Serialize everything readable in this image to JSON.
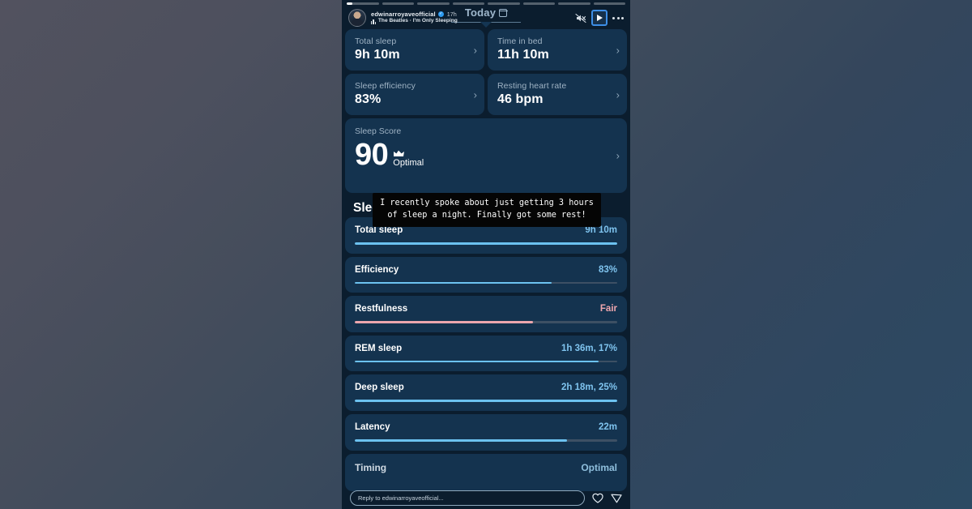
{
  "story": {
    "progress": {
      "segments": 8,
      "active_index": 0,
      "active_fill_percent": 18
    },
    "header": {
      "username": "edwinarroyaveofficial",
      "verified_glyph": "✓",
      "timestamp": "17h",
      "music": "The Beatles · I'm Only Sleeping",
      "mute_icon": "muted-speaker-icon",
      "play_icon": "play-icon",
      "more_icon": "more-options-icon"
    },
    "date_pill": {
      "label": "Today",
      "icon": "calendar-icon"
    },
    "caption": "I recently spoke about just getting 3 hours of sleep a night. Finally got some rest!",
    "reply": {
      "placeholder": "Reply to edwinarroyaveofficial...",
      "heart_icon": "heart-icon",
      "send_icon": "send-icon"
    }
  },
  "summary_cards": [
    {
      "label": "Total sleep",
      "value": "9h 10m",
      "chevron": "›"
    },
    {
      "label": "Time in bed",
      "value": "11h 10m",
      "chevron": "›"
    },
    {
      "label": "Sleep efficiency",
      "value": "83%",
      "chevron": "›"
    },
    {
      "label": "Resting heart rate",
      "value": "46 bpm",
      "chevron": "›"
    }
  ],
  "sleep_score": {
    "label": "Sleep Score",
    "score": "90",
    "tag": "Optimal",
    "crown_icon": "crown-icon",
    "chevron": "›"
  },
  "section_heading": "Sleep",
  "metrics": [
    {
      "name": "Total sleep",
      "value": "9h 10m",
      "percent": 100,
      "tone": "blue"
    },
    {
      "name": "Efficiency",
      "value": "83%",
      "percent": 75,
      "tone": "blue"
    },
    {
      "name": "Restfulness",
      "value": "Fair",
      "percent": 68,
      "tone": "pink"
    },
    {
      "name": "REM sleep",
      "value": "1h 36m, 17%",
      "percent": 93,
      "tone": "blue"
    },
    {
      "name": "Deep sleep",
      "value": "2h 18m, 25%",
      "percent": 100,
      "tone": "blue"
    },
    {
      "name": "Latency",
      "value": "22m",
      "percent": 81,
      "tone": "blue"
    }
  ],
  "timing": {
    "name": "Timing",
    "value": "Optimal"
  },
  "colors": {
    "card_bg": "#14334f",
    "story_bg": "#0b1d2e",
    "accent_blue": "#6cc2f0",
    "accent_pink": "#eca6ad",
    "value_blue": "#7fc4ef",
    "verified_blue": "#2d9bf0"
  }
}
